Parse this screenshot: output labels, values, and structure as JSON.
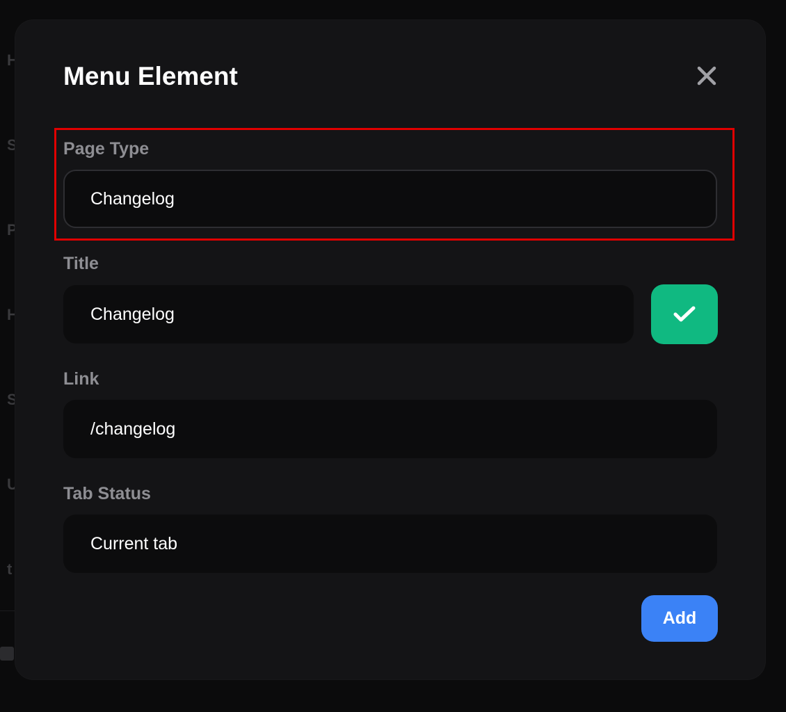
{
  "modal": {
    "title": "Menu Element",
    "fields": {
      "page_type": {
        "label": "Page Type",
        "value": "Changelog"
      },
      "title": {
        "label": "Title",
        "value": "Changelog"
      },
      "link": {
        "label": "Link",
        "value": "/changelog"
      },
      "tab_status": {
        "label": "Tab Status",
        "value": "Current tab"
      }
    },
    "add_label": "Add",
    "icons": {
      "close": "close-icon",
      "confirm": "checkmark-icon"
    },
    "colors": {
      "confirm": "#10b981",
      "primary": "#3b82f6",
      "highlight": "#e00000"
    }
  }
}
